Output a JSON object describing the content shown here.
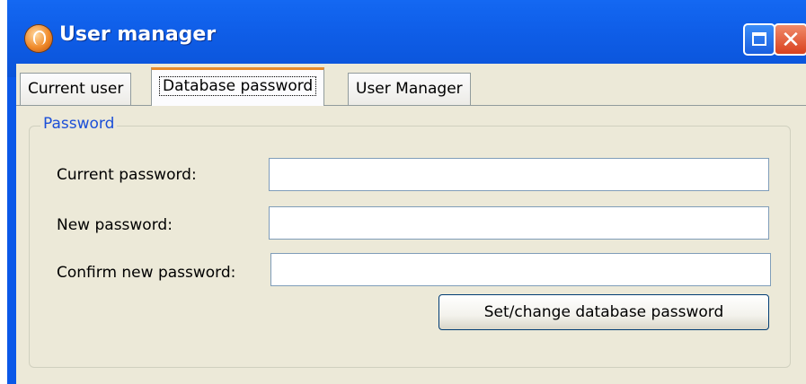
{
  "window": {
    "title": "User manager",
    "icon": "app-logo-icon",
    "controls": {
      "maximize_icon": "maximize-icon",
      "close_icon": "close-icon",
      "close_glyph": "✕"
    }
  },
  "tabs": [
    {
      "label": "Current user",
      "active": false
    },
    {
      "label": "Database password",
      "active": true
    },
    {
      "label": "User Manager",
      "active": false
    }
  ],
  "password_group": {
    "legend": "Password",
    "fields": {
      "current": {
        "label": "Current password:",
        "value": ""
      },
      "new": {
        "label": "New password:",
        "value": ""
      },
      "confirm": {
        "label": "Confirm new password:",
        "value": ""
      }
    },
    "submit_label": "Set/change database password"
  },
  "colors": {
    "titlebar": "#0a58e8",
    "panel": "#ece9d8",
    "group_legend": "#1b4fd8",
    "active_tab_accent": "#e68b2c",
    "close_button": "#d9411e"
  }
}
